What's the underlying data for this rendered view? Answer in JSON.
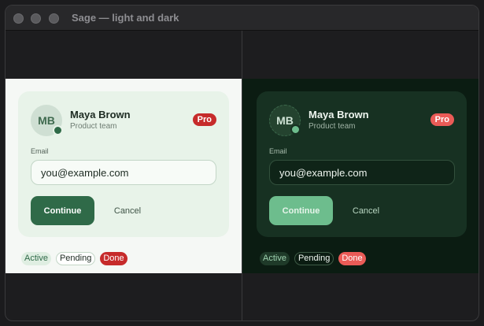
{
  "window": {
    "title": "Sage — light and dark"
  },
  "panels": [
    {
      "theme": "light",
      "profile": {
        "initials": "MB",
        "name": "Maya Brown",
        "team": "Product team",
        "badge": "Pro"
      },
      "form": {
        "email_label": "Email",
        "email_value": "you@example.com",
        "continue_label": "Continue",
        "cancel_label": "Cancel"
      },
      "chips": [
        "Active",
        "Pending",
        "Done"
      ]
    },
    {
      "theme": "dark",
      "profile": {
        "initials": "MB",
        "name": "Maya Brown",
        "team": "Product team",
        "badge": "Pro"
      },
      "form": {
        "email_label": "Email",
        "email_value": "you@example.com",
        "continue_label": "Continue",
        "cancel_label": "Cancel"
      },
      "chips": [
        "Active",
        "Pending",
        "Done"
      ]
    }
  ],
  "colors": {
    "accent_light": "#2f6a48",
    "accent_dark": "#6dbd8d",
    "badge_light": "#c62b2b",
    "badge_dark": "#ea5b57"
  }
}
